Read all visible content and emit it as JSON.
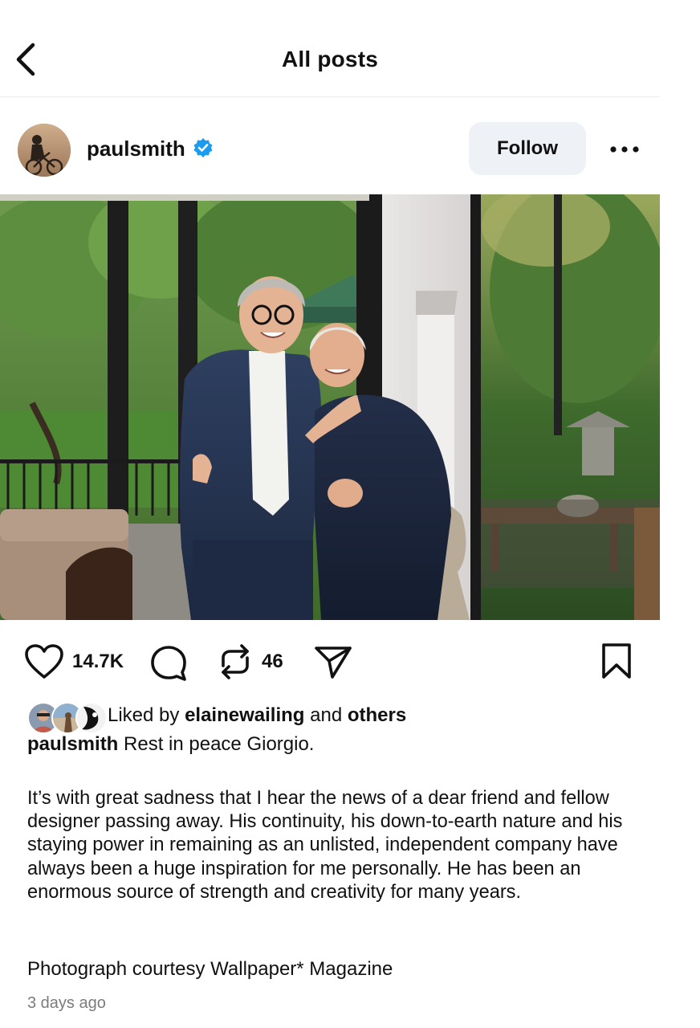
{
  "header": {
    "title": "All posts",
    "back_icon": "chevron-left-icon"
  },
  "post": {
    "username": "paulsmith",
    "verified": true,
    "follow_label": "Follow",
    "more_icon": "more-horizontal-icon",
    "image_alt": "Two smiling men in dark suits posing in front of glass doors opening onto a garden"
  },
  "actions": {
    "likes": "14.7K",
    "reposts": "46",
    "like_icon": "heart-icon",
    "comment_icon": "comment-icon",
    "repost_icon": "repost-icon",
    "share_icon": "send-icon",
    "save_icon": "bookmark-icon"
  },
  "liked_by": {
    "prefix": "Liked by",
    "user": "elainewailing",
    "conjunction": "and",
    "suffix": "others"
  },
  "caption": {
    "username": "paulsmith",
    "first_line": "Rest in peace Giorgio.",
    "body": "It’s with great sadness that I hear the news of a dear friend and fellow designer passing away. His continuity, his down-to-earth nature and his staying power in remaining as an unlisted, independent company have always been a huge inspiration for me personally. He has been an enormous source of strength and creativity for many years.",
    "credit": "Photograph courtesy Wallpaper* Magazine",
    "timestamp": "3 days ago"
  },
  "colors": {
    "verified": "#1d9bf0",
    "follow_bg": "#eef1f5",
    "muted": "#7c7c7c"
  }
}
